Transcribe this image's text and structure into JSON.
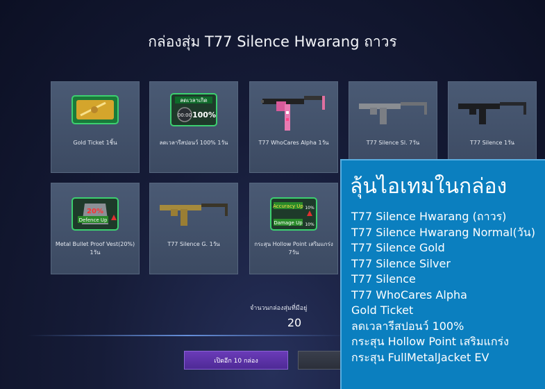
{
  "header": {
    "title": "กล่องสุ่ม T77 Silence Hwarang ถาวร"
  },
  "items": [
    {
      "name": "Gold Ticket 1ชิ้น",
      "icon": "gold-ticket-icon"
    },
    {
      "name": "ลดเวลารีสปอนว์ 100% 1วัน",
      "icon": "respawn-icon",
      "icon_text": "ลดเวลาเกิด",
      "icon_text2": "00:00",
      "icon_text3": "100%"
    },
    {
      "name": "T77 WhoCares Alpha 1วัน",
      "icon": "pink-gun-icon"
    },
    {
      "name": "T77 Silence Sl. 7วัน",
      "icon": "silver-gun-icon"
    },
    {
      "name": "T77 Silence 1วัน",
      "icon": "black-gun-icon"
    },
    {
      "name": "Metal Bullet Proof Vest(20%) 1วัน",
      "icon": "defence-up-icon",
      "icon_text": "20%",
      "icon_text2": "Defence Up"
    },
    {
      "name": "T77 Silence G. 1วัน",
      "icon": "gold-gun-icon"
    },
    {
      "name": "กระสุน Hollow Point เสริมแกร่ง 7วัน",
      "icon": "accuracy-damage-icon",
      "icon_text": "Accuracy Up",
      "icon_text2": "Damage Up",
      "icon_text3": "10%",
      "icon_text4": "10%"
    }
  ],
  "footer": {
    "count_label": "จำนวนกล่องสุ่มที่มีอยู่",
    "count_value": "20",
    "open_button": "เปิดอีก 10 กล่อง"
  },
  "panel": {
    "heading": "ลุ้นไอเทมในกล่อง",
    "list": [
      "T77 Silence Hwarang (ถาวร)",
      "T77 Silence Hwarang Normal(วัน)",
      "T77 Silence Gold",
      "T77 Silence Silver",
      "T77 Silence",
      "T77 WhoCares Alpha",
      "Gold Ticket",
      "ลดเวลารีสปอนว์ 100%",
      "กระสุน Hollow Point เสริมแกร่ง",
      "กระสุน FullMetalJacket EV"
    ]
  },
  "colors": {
    "panel_bg": "#0b7fbf",
    "open_button": "#5a30a8",
    "card_bg": "#44536c"
  }
}
